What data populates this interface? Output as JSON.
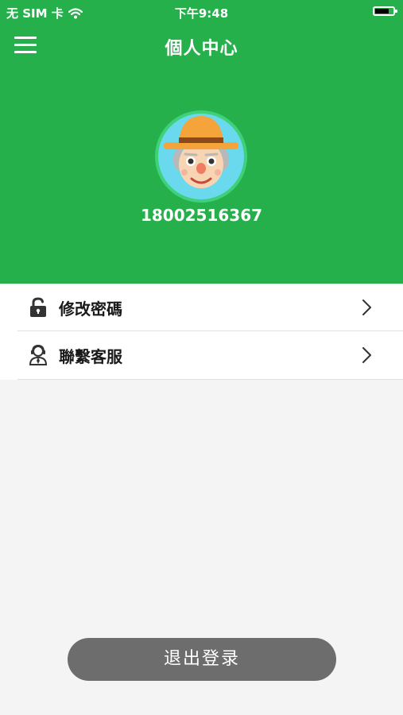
{
  "status_bar": {
    "carrier": "无 SIM 卡",
    "time": "下午9:48",
    "icons": [
      "wifi-icon",
      "battery-icon"
    ]
  },
  "nav": {
    "title": "個人中心",
    "menu_icon": "hamburger-menu-icon"
  },
  "profile": {
    "avatar": "farmer-avatar-icon",
    "phone": "18002516367"
  },
  "menu": {
    "items": [
      {
        "label": "修改密碼",
        "icon": "unlock-icon"
      },
      {
        "label": "聯繫客服",
        "icon": "customer-service-icon"
      }
    ]
  },
  "logout": {
    "label": "退出登录"
  },
  "colors": {
    "header_green": "#25b04b",
    "page_background": "#f4f4f4",
    "logout_button": "#6d6d6d",
    "avatar_background": "#6ad9ed"
  }
}
